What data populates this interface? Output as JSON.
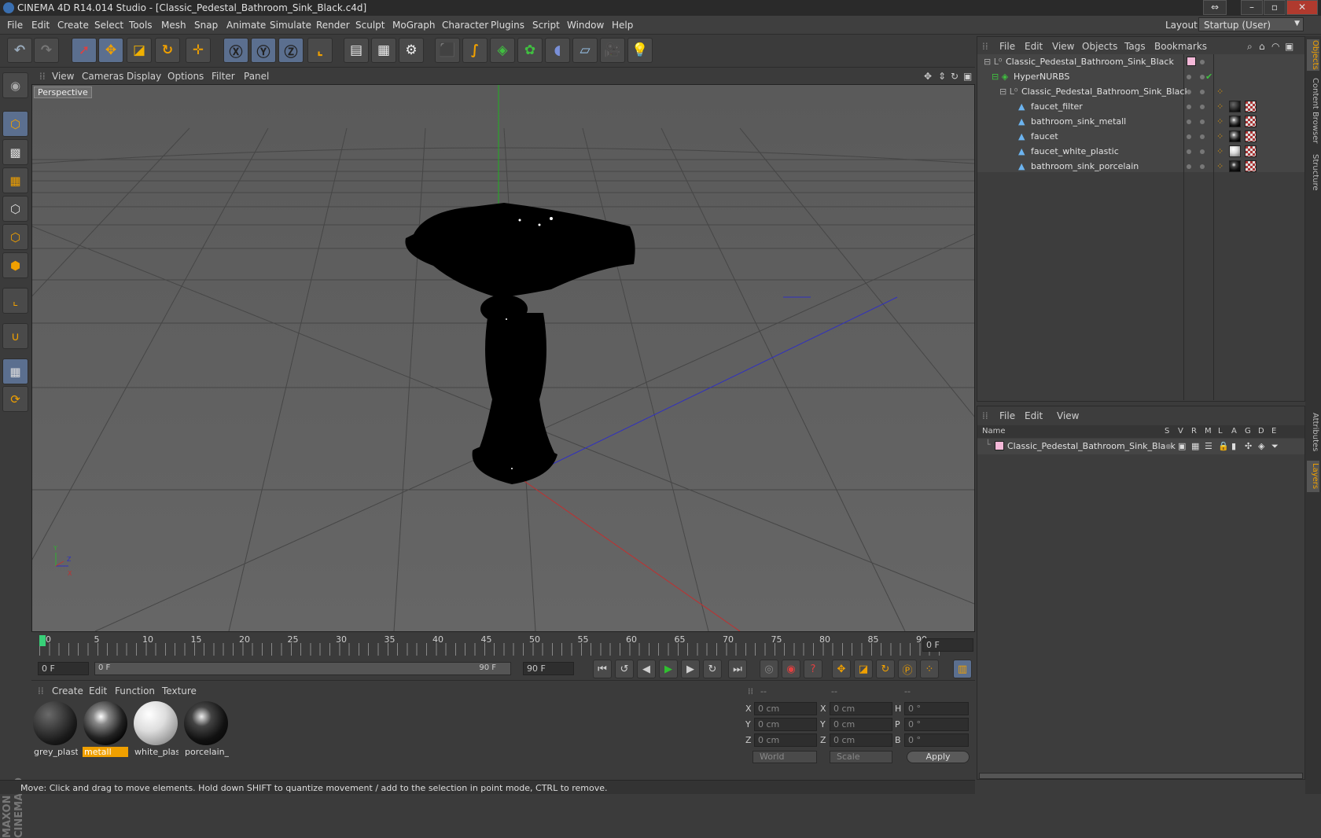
{
  "window": {
    "title": "CINEMA 4D R14.014 Studio - [Classic_Pedestal_Bathroom_Sink_Black.c4d]"
  },
  "menu": [
    "File",
    "Edit",
    "Create",
    "Select",
    "Tools",
    "Mesh",
    "Snap",
    "Animate",
    "Simulate",
    "Render",
    "Sculpt",
    "MoGraph",
    "Character",
    "Plugins",
    "Script",
    "Window",
    "Help"
  ],
  "layout": {
    "label": "Layout:",
    "value": "Startup (User)"
  },
  "viewport": {
    "menu": [
      "View",
      "Cameras",
      "Display",
      "Options",
      "Filter",
      "Panel"
    ],
    "label": "Perspective"
  },
  "timeline": {
    "ticks": [
      "0",
      "5",
      "10",
      "15",
      "20",
      "25",
      "30",
      "35",
      "40",
      "45",
      "50",
      "55",
      "60",
      "65",
      "70",
      "75",
      "80",
      "85",
      "90"
    ],
    "current_frame": "0 F",
    "start_field": "0 F",
    "range_start": "0 F",
    "range_end": "90 F",
    "end_field": "90 F"
  },
  "material_manager": {
    "menu": [
      "Create",
      "Edit",
      "Function",
      "Texture"
    ],
    "materials": [
      {
        "name": "grey_plasti",
        "style": "grey",
        "selected": false
      },
      {
        "name": "metall",
        "style": "metal",
        "selected": true
      },
      {
        "name": "white_plas",
        "style": "white",
        "selected": false
      },
      {
        "name": "porcelain_l",
        "style": "porc",
        "selected": false
      }
    ]
  },
  "coordinates": {
    "headers": [
      "--",
      "--",
      "--"
    ],
    "rows": [
      {
        "axis": "X",
        "pos": "0 cm",
        "axis2": "X",
        "size": "0 cm",
        "rot_label": "H",
        "rot": "0 °"
      },
      {
        "axis": "Y",
        "pos": "0 cm",
        "axis2": "Y",
        "size": "0 cm",
        "rot_label": "P",
        "rot": "0 °"
      },
      {
        "axis": "Z",
        "pos": "0 cm",
        "axis2": "Z",
        "size": "0 cm",
        "rot_label": "B",
        "rot": "0 °"
      }
    ],
    "mode1": "World",
    "mode2": "Scale",
    "apply": "Apply"
  },
  "status": "Move: Click and drag to move elements. Hold down SHIFT to quantize movement / add to the selection in point mode, CTRL to remove.",
  "object_manager": {
    "menu": [
      "File",
      "Edit",
      "View",
      "Objects",
      "Tags",
      "Bookmarks"
    ],
    "objects": [
      {
        "name": "Classic_Pedestal_Bathroom_Sink_Black",
        "icon": "null-icon"
      },
      {
        "name": "HyperNURBS",
        "icon": "hypernurbs-icon"
      },
      {
        "name": "Classic_Pedestal_Bathroom_Sink_Black",
        "icon": "null-icon"
      },
      {
        "name": "faucet_filter",
        "icon": "polygon-icon"
      },
      {
        "name": "bathroom_sink_metall",
        "icon": "polygon-icon"
      },
      {
        "name": "faucet",
        "icon": "polygon-icon"
      },
      {
        "name": "faucet_white_plastic",
        "icon": "polygon-icon"
      },
      {
        "name": "bathroom_sink_porcelain",
        "icon": "polygon-icon"
      }
    ]
  },
  "layer_manager": {
    "menu": [
      "File",
      "Edit",
      "View"
    ],
    "columns": [
      "Name",
      "S",
      "V",
      "R",
      "M",
      "L",
      "A",
      "G",
      "D",
      "E"
    ],
    "layers": [
      {
        "name": "Classic_Pedestal_Bathroom_Sink_Black",
        "color": "#f4b8d8"
      }
    ]
  },
  "right_tabs": [
    "Objects",
    "Content Browser",
    "Structure",
    "Attributes",
    "Layers"
  ],
  "colors": {
    "accent": "#f0a000",
    "axis_x": "#c03030",
    "axis_y": "#30b030",
    "axis_z": "#3030c0"
  }
}
